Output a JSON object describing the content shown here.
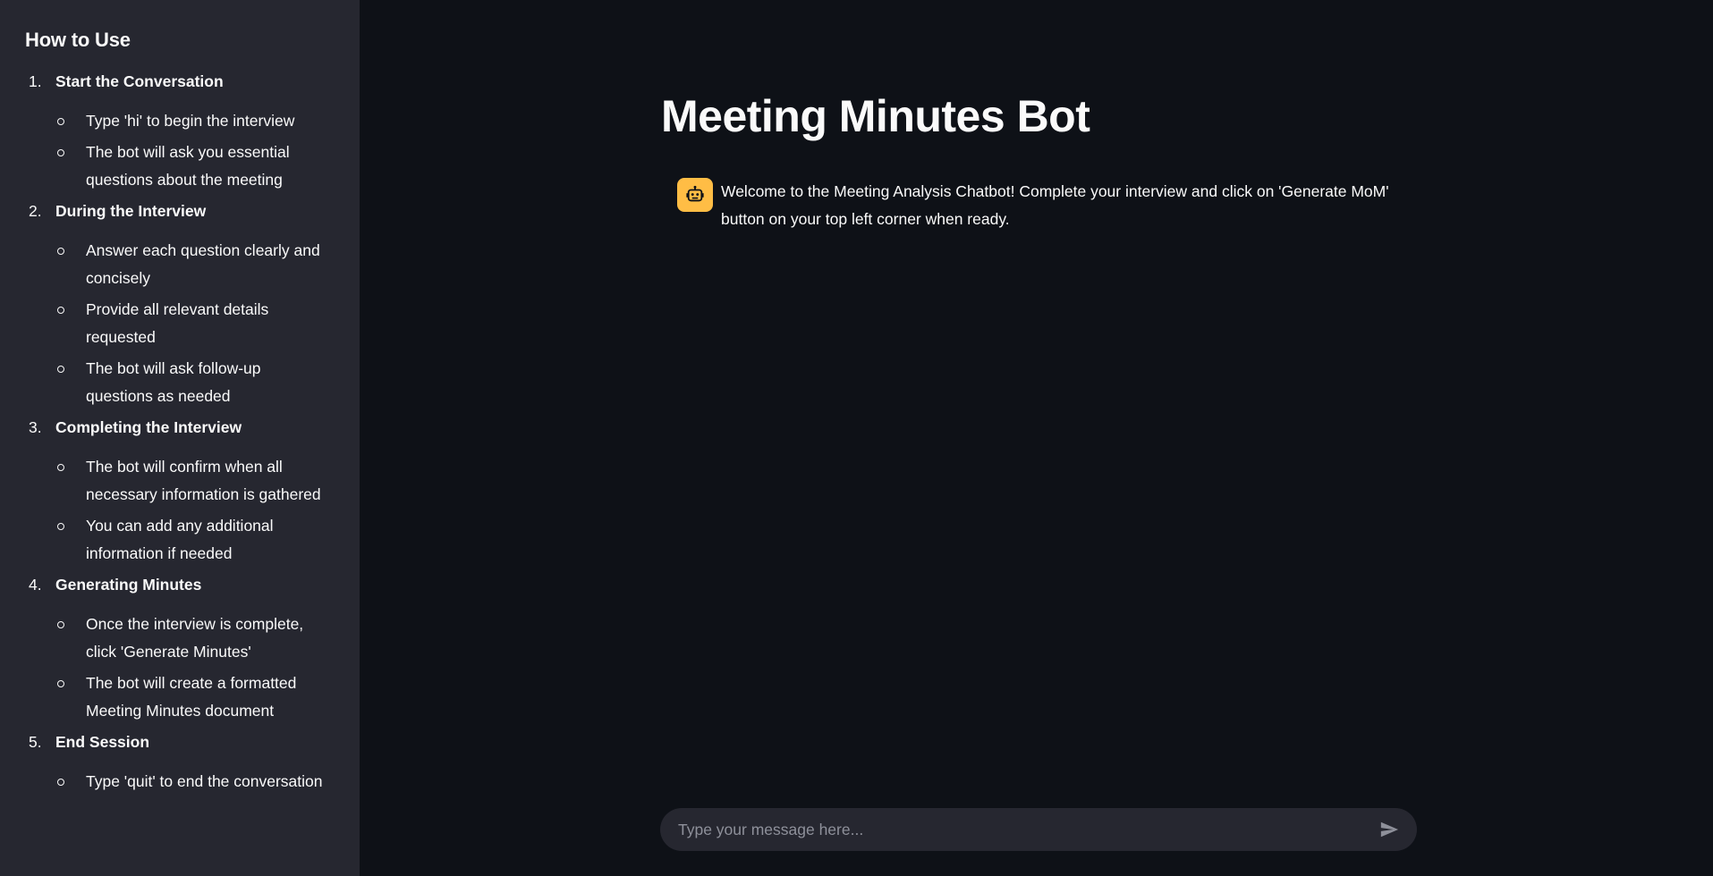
{
  "sidebar": {
    "heading": "How to Use",
    "steps": [
      {
        "num": "1.",
        "title": "Start the Conversation",
        "items": [
          "Type 'hi' to begin the interview",
          "The bot will ask you essential questions about the meeting"
        ]
      },
      {
        "num": "2.",
        "title": "During the Interview",
        "items": [
          "Answer each question clearly and concisely",
          "Provide all relevant details requested",
          "The bot will ask follow-up questions as needed"
        ]
      },
      {
        "num": "3.",
        "title": "Completing the Interview",
        "items": [
          "The bot will confirm when all necessary information is gathered",
          "You can add any additional information if needed"
        ]
      },
      {
        "num": "4.",
        "title": "Generating Minutes",
        "items": [
          "Once the interview is complete, click 'Generate Minutes'",
          "The bot will create a formatted Meeting Minutes document"
        ]
      },
      {
        "num": "5.",
        "title": "End Session",
        "items": [
          "Type 'quit' to end the conversation"
        ]
      }
    ]
  },
  "main": {
    "title": "Meeting Minutes Bot",
    "messages": [
      {
        "role": "assistant",
        "avatar_icon": "robot-icon",
        "text": "Welcome to the Meeting Analysis Chatbot! Complete your interview and click on 'Generate MoM' button on your top left corner when ready."
      }
    ],
    "chat_input": {
      "placeholder": "Type your message here...",
      "value": "",
      "send_icon": "send-icon"
    }
  },
  "colors": {
    "background": "#0e1117",
    "sidebar": "#262730",
    "avatar": "#ffbd45",
    "text": "#fafafa",
    "placeholder": "#8e909a"
  }
}
